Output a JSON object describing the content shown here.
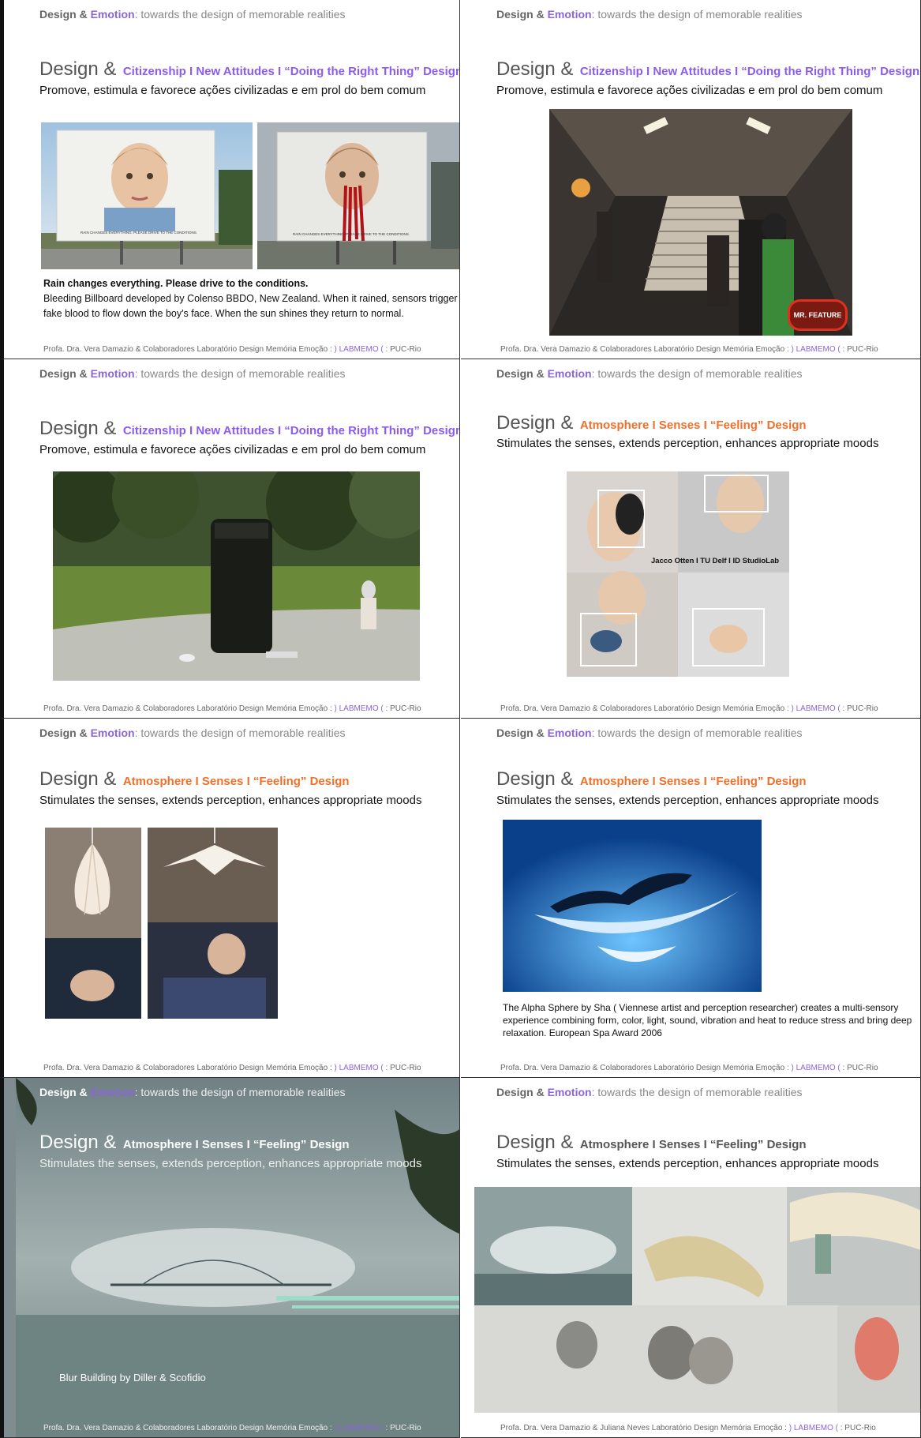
{
  "header": {
    "design": "Design",
    "amp": "&",
    "emotion": "Emotion",
    "rest": ": towards the design of memorable realities"
  },
  "titles": {
    "design_amp": "Design &",
    "citizenship": "Citizenship I New Attitudes I “Doing the Right Thing” Design",
    "atmosphere": "Atmosphere I Senses I “Feeling” Design"
  },
  "subtitles": {
    "citizenship": "Promove, estimula e favorece ações civilizadas e em prol do bem comum",
    "atmosphere": "Stimulates the senses, extends perception, enhances appropriate moods"
  },
  "footer": {
    "prefix": "Profa. Dra. Vera Damazio & Colaboradores Laboratório Design Memória Emoção : ",
    "prefix_last": "Profa. Dra. Vera Damazio & Juliana Neves Laboratório Design Memória Emoção : ",
    "lab": ") LABMEMO (",
    "suffix": " :  PUC-Rio"
  },
  "slide1": {
    "caption_bold": "Rain changes everything. Please drive to the conditions.",
    "caption_body": "Bleeding Billboard developed by Colenso BBDO, New Zealand. When it rained, sensors trigger fake blood to flow down the boy's face. When the sun shines they return to normal.",
    "billboard_text_1": "RAIN CHANGES EVERYTHING. PLEASE DRIVE TO THE CONDITIONS.",
    "billboard_text_2": "RAIN CHANGES EVERYTHING. PLEASE DRIVE TO THE CONDITIONS."
  },
  "slide2": {
    "badge": "MR. FEATURE"
  },
  "slide4": {
    "photo_label": "Jacco Otten I TU Delf I ID StudioLab"
  },
  "slide6": {
    "caption": "The Alpha Sphere by Sha ( Viennese artist and perception researcher) creates a multi-sensory experience combining form, color, light, sound, vibration and heat to reduce stress and bring deep relaxation. European Spa Award 2006"
  },
  "slide7": {
    "caption": "Blur Building by Diller & Scofidio"
  },
  "colors": {
    "purple": "#8a5cf0",
    "orange": "#f0702a",
    "emotion": "#8a66d8"
  }
}
